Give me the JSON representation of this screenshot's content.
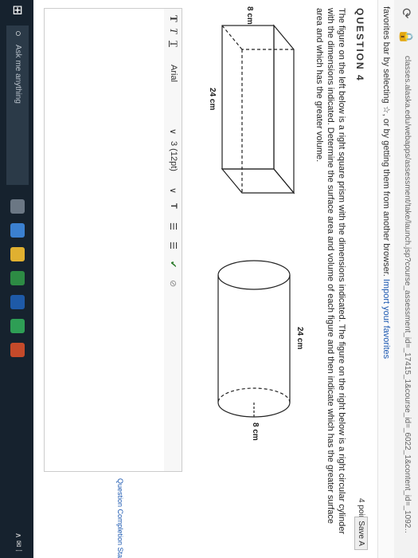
{
  "browser": {
    "url": "classes.alaska.edu/webapps/assessment/take/launch.jsp?course_assessment_id=_17415_1&course_id=_6022_1&content_id=_1092…",
    "favorites_text": "favorites bar by selecting ☆, or by getting them from another browser.",
    "favorites_link": "Import your favorites"
  },
  "question": {
    "title": "QUESTION 4",
    "points": "4 points",
    "save_label": "Save A",
    "text": "The figure on the left below is a right square prism with the dimensions indicated. The figure on the right below is a right circular cylinder with the dimensions indicated. Determine the surface area and volume of each figure and then indicate which has the greater surface area and which has the greater volume."
  },
  "figures": {
    "prism": {
      "height_label": "8 cm",
      "length_label": "24 cm"
    },
    "cylinder": {
      "height_label": "24 cm",
      "diameter_label": "8 cm"
    }
  },
  "editor_toolbar": {
    "format_buttons": [
      "T",
      "T",
      "T"
    ],
    "font": "Arial",
    "size": "3 (12pt)",
    "text_color": "T",
    "list1": "☰",
    "list2": "☰"
  },
  "status": {
    "question_status": "Question Completion Status:"
  },
  "taskbar": {
    "search_placeholder": "Ask me anything",
    "system_tray": "∧ ✉ ⁞"
  },
  "colors": {
    "link": "#1a57b0",
    "taskbar": "#16222e"
  }
}
